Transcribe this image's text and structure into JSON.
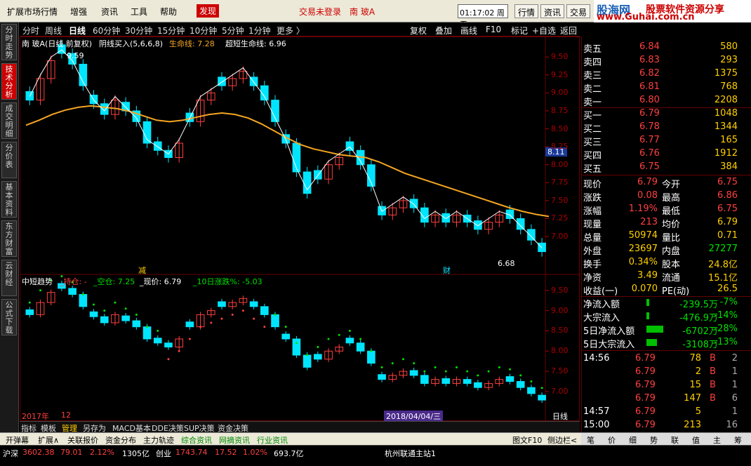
{
  "menu": {
    "items": [
      "扩展市场行情",
      "增强",
      "资讯",
      "工具",
      "帮助",
      "发现"
    ],
    "login": "交易未登录",
    "stock": "南 玻A",
    "clock": "01:17:02 周五",
    "right_buttons": [
      "行情",
      "资讯",
      "交易"
    ],
    "brand_top": "股海网",
    "brand_sub": "股票软件资源分享",
    "brand_url": "www.Guhai.com.cn"
  },
  "leftbar": {
    "tabs": [
      "分时走势",
      "技术分析",
      "成交明细",
      "分价表",
      "基本资料",
      "东方财富",
      "云财经",
      "公式下载"
    ]
  },
  "periods": {
    "items": [
      "分时",
      "周线",
      "日线",
      "60分钟",
      "30分钟",
      "15分钟",
      "10分钟",
      "5分钟",
      "1分钟",
      "更多 〉"
    ],
    "tools": [
      "复权",
      "叠加",
      "画线",
      "F10",
      "标记",
      "+自选",
      "返回"
    ]
  },
  "main_indicator": {
    "name": "南 玻A(日线 前复权)",
    "line1": "阴线买入(5,6,6,8)",
    "line2_label": "生命线: 7.28",
    "line3_label": "超短生命线: 6.96",
    "high_label": "9.59",
    "low_label": "6.68",
    "price_badge": "8.11",
    "yticks": [
      "9.50",
      "9.25",
      "9.00",
      "8.75",
      "8.50",
      "8.25",
      "8.00",
      "7.75",
      "7.50",
      "7.25",
      "7.00"
    ],
    "marker1": "减",
    "marker2": "财"
  },
  "sub_indicator": {
    "name": "中短趋势",
    "hold": "_持仓: -",
    "empty": "_空仓: 7.25",
    "price": "_现价: 6.79",
    "change": "_10日涨跌%: -5.03",
    "yticks": [
      "9.50",
      "9.00",
      "8.50",
      "8.00",
      "7.50",
      "7.00"
    ]
  },
  "xaxis": {
    "year": "2017年",
    "month": "12",
    "date_badge": "2018/04/04/三",
    "period": "日线"
  },
  "bottomtabs": [
    "指标",
    "模板",
    "管理",
    "另存为",
    "MACD基本",
    "DDE决策",
    "SUP决策",
    "资金决策"
  ],
  "toolbar2": {
    "items": [
      "开弹幕",
      "扩展∧",
      "关联报价",
      "资金分布",
      "主力轨迹",
      "综合资讯",
      "网摘资讯",
      "行业资讯"
    ],
    "right": [
      "图文F10",
      "侧边栏<"
    ],
    "quote_tabs": [
      "笔",
      "价",
      "细",
      "势",
      "联",
      "值",
      "主",
      "筹"
    ]
  },
  "statusbar": {
    "sh_label": "沪深",
    "sh_index": "3602.38",
    "sh_chg": "79.01",
    "sh_pct": "2.12%",
    "sh_amt": "1305亿",
    "cy_label": "创业",
    "cy_index": "1743.74",
    "cy_chg": "17.52",
    "cy_pct": "1.02%",
    "cy_amt": "693.7亿",
    "server": "杭州联通主站1"
  },
  "orderbook": {
    "sell": [
      {
        "label": "卖五",
        "price": "6.84",
        "vol": "580"
      },
      {
        "label": "卖四",
        "price": "6.83",
        "vol": "293"
      },
      {
        "label": "卖三",
        "price": "6.82",
        "vol": "1375"
      },
      {
        "label": "卖二",
        "price": "6.81",
        "vol": "768"
      },
      {
        "label": "卖一",
        "price": "6.80",
        "vol": "2208"
      }
    ],
    "buy": [
      {
        "label": "买一",
        "price": "6.79",
        "vol": "1048"
      },
      {
        "label": "买二",
        "price": "6.78",
        "vol": "1344"
      },
      {
        "label": "买三",
        "price": "6.77",
        "vol": "165"
      },
      {
        "label": "买四",
        "price": "6.76",
        "vol": "1912"
      },
      {
        "label": "买五",
        "price": "6.75",
        "vol": "384"
      }
    ]
  },
  "stats": [
    {
      "l1": "现价",
      "v1": "6.79",
      "l2": "今开",
      "v2": "6.75"
    },
    {
      "l1": "涨跌",
      "v1": "0.08",
      "l2": "最高",
      "v2": "6.86"
    },
    {
      "l1": "涨幅",
      "v1": "1.19%",
      "l2": "最低",
      "v2": "6.75"
    },
    {
      "l1": "现量",
      "v1": "213",
      "l2": "均价",
      "v2": "6.79"
    },
    {
      "l1": "总量",
      "v1": "50974",
      "l2": "量比",
      "v2": "0.71"
    },
    {
      "l1": "外盘",
      "v1": "23697",
      "l2": "内盘",
      "v2": "27277"
    },
    {
      "l1": "换手",
      "v1": "0.34%",
      "l2": "股本",
      "v2": "24.8亿"
    },
    {
      "l1": "净资",
      "v1": "3.49",
      "l2": "流通",
      "v2": "15.1亿"
    },
    {
      "l1": "收益(一)",
      "v1": "0.070",
      "l2": "PE(动)",
      "v2": "26.5"
    }
  ],
  "flows": [
    {
      "label": "净流入额",
      "val": "-239.5万",
      "pct": "-7%",
      "bar": 0.05
    },
    {
      "label": "大宗流入",
      "val": "-476.9万",
      "pct": "-14%",
      "bar": 0.05
    },
    {
      "label": "5日净流入额",
      "val": "-6702万",
      "pct": "-28%",
      "bar": 0.7
    },
    {
      "label": "5日大宗流入",
      "val": "-3108万",
      "pct": "-13%",
      "bar": 0.4
    }
  ],
  "ticks": [
    {
      "time": "14:56",
      "price": "6.79",
      "vol": "78",
      "side": "B",
      "n": "2"
    },
    {
      "time": "",
      "price": "6.79",
      "vol": "2",
      "side": "B",
      "n": "1"
    },
    {
      "time": "",
      "price": "6.79",
      "vol": "15",
      "side": "B",
      "n": "1"
    },
    {
      "time": "",
      "price": "6.79",
      "vol": "147",
      "side": "B",
      "n": "6"
    },
    {
      "time": "14:57",
      "price": "6.79",
      "vol": "5",
      "side": "",
      "n": "1"
    },
    {
      "time": "15:00",
      "price": "6.79",
      "vol": "213",
      "side": "",
      "n": "16"
    }
  ],
  "chart_data": {
    "type": "candlestick",
    "price_range": [
      6.6,
      9.6
    ],
    "life_line": [
      8.55,
      8.62,
      8.7,
      8.76,
      8.8,
      8.82,
      8.8,
      8.78,
      8.74,
      8.68,
      8.62,
      8.6,
      8.62,
      8.66,
      8.7,
      8.72,
      8.7,
      8.65,
      8.57,
      8.47,
      8.37,
      8.28,
      8.22,
      8.18,
      8.14,
      8.12,
      8.1,
      8.04,
      7.96,
      7.88,
      7.82,
      7.76,
      7.7,
      7.64,
      7.58,
      7.52,
      7.46,
      7.4,
      7.35,
      7.31,
      7.28
    ],
    "closes": [
      8.9,
      9.2,
      9.45,
      9.55,
      9.4,
      9.1,
      8.85,
      8.7,
      8.9,
      8.75,
      8.6,
      8.3,
      8.2,
      8.1,
      8.3,
      8.6,
      8.9,
      9.0,
      9.1,
      9.2,
      9.3,
      9.1,
      8.9,
      8.6,
      8.3,
      7.9,
      7.6,
      7.8,
      8.0,
      8.1,
      8.2,
      8.0,
      7.7,
      7.3,
      7.4,
      7.5,
      7.4,
      7.2,
      7.3,
      7.2,
      7.3,
      7.2,
      7.1,
      7.2,
      7.3,
      7.25,
      7.1,
      6.95,
      6.79
    ]
  }
}
